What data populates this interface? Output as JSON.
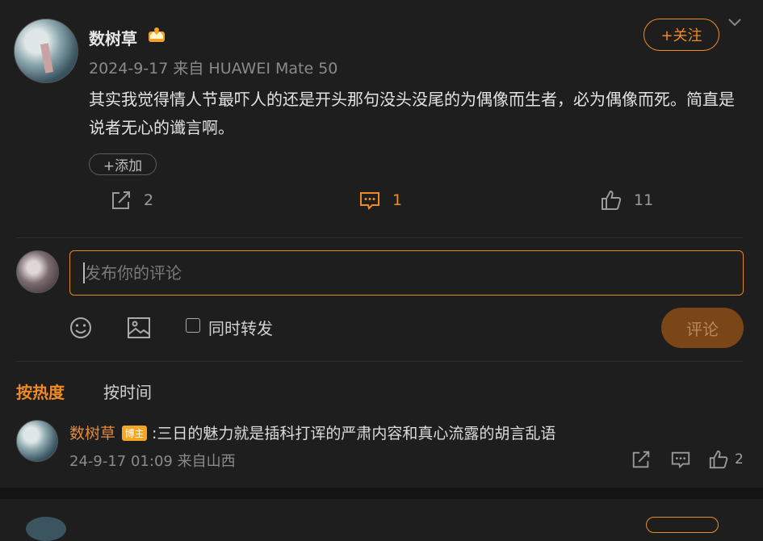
{
  "post": {
    "author": "数树草",
    "meta": "2024-9-17  来自 HUAWEI Mate 50",
    "follow_label": "+关注",
    "text": "其实我觉得情人节最吓人的还是开头那句没头没尾的为偶像而生者，必为偶像而死。简直是说者无心的谶言啊。",
    "add_tag_label": "+添加",
    "repost_count": "2",
    "comment_count": "1",
    "like_count": "11",
    "accent_color": "#f08a24"
  },
  "composer": {
    "placeholder": "发布你的评论",
    "repost_label": "同时转发",
    "submit_label": "评论",
    "icons": [
      "emoji-icon",
      "image-icon"
    ]
  },
  "sort": {
    "hot_label": "按热度",
    "time_label": "按时间"
  },
  "comments": [
    {
      "author": "数树草",
      "badge": "博主",
      "text": ":三日的魅力就是插科打诨的严肃内容和真心流露的胡言乱语",
      "meta": "24-9-17 01:09 来自山西",
      "like_count": "2"
    }
  ]
}
